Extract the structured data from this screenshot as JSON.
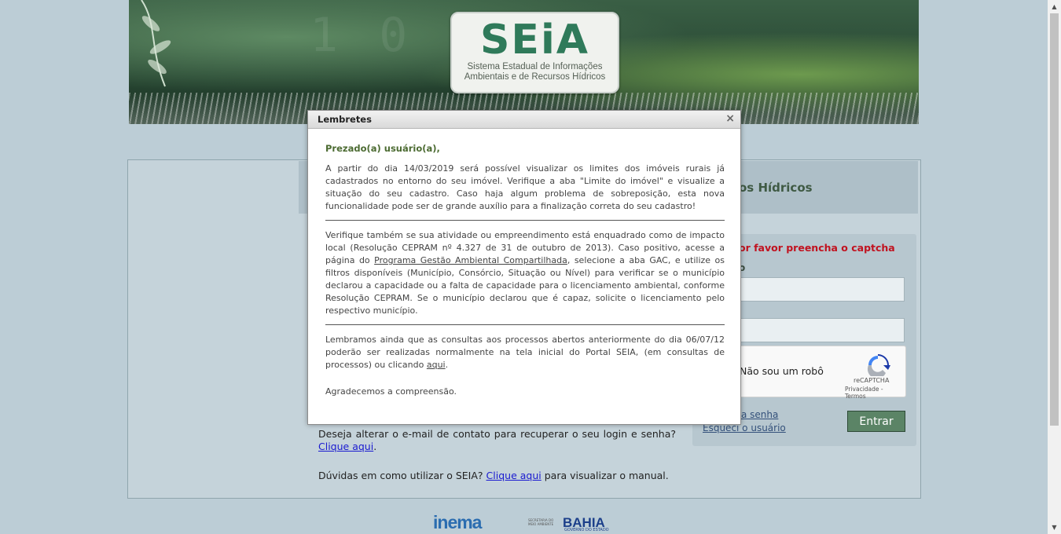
{
  "header": {
    "logo_word": "SEiA",
    "logo_sub_line1": "Sistema Estadual de Informações",
    "logo_sub_line2": "Ambientais e de Recursos Hídricos"
  },
  "panel": {
    "title_visible": "os Hídricos"
  },
  "login": {
    "captcha_message": "or favor preencha o captcha",
    "field_label": "o",
    "recaptcha_label": "Não sou um robô",
    "recaptcha_brand": "reCAPTCHA",
    "recaptcha_terms": "Privacidade - Termos",
    "link_senha": "a senha",
    "link_usuario": "Esqueci o usuário",
    "submit_label": "Entrar"
  },
  "lower": {
    "email_question": "Deseja alterar o e-mail de contato para recuperar o seu login e senha?",
    "email_link": "Clique aqui",
    "email_tail": ".",
    "manual_prefix": "Dúvidas em como utilizar o SEIA?",
    "manual_link": "Clique aqui",
    "manual_suffix": "para visualizar o manual."
  },
  "footer": {
    "inema": "inema",
    "sema_line1": "SECRETARIA DO",
    "sema_line2": "MEIO AMBIENTE",
    "bahia": "BAHIA",
    "bahia_sub": "GOVERNO DO ESTADO"
  },
  "modal": {
    "title": "Lembretes",
    "close": "×",
    "greeting": "Prezado(a) usuário(a),",
    "p1": "A partir do dia 14/03/2019 será possível visualizar os limites dos imóveis rurais já cadastrados no entorno do seu imóvel. Verifique a aba \"Limite do imóvel\" e visualize a situação do seu cadastro. Caso haja algum problema de sobreposição, esta nova funcionalidade pode ser de grande auxílio para a finalização correta do seu cadastro!",
    "p2_before_link": "Verifique também se sua atividade ou empreendimento está enquadrado como de impacto local (Resolução CEPRAM nº 4.327 de 31 de outubro de 2013). Caso positivo, acesse a página do ",
    "p2_link": "Programa Gestão Ambiental Compartilhada",
    "p2_after_link": ", selecione a aba GAC, e utilize os filtros disponíveis (Município, Consórcio, Situação ou Nível) para verificar se o município declarou a capacidade ou a falta de capacidade para o licenciamento ambiental, conforme Resolução CEPRAM. Se o município declarou que é capaz, solicite o licenciamento pelo respectivo município.",
    "p3_before_link": "Lembramos ainda que as consultas aos processos abertos anteriormente do dia 06/07/12 poderão ser realizadas normalmente na tela inicial do Portal SEIA, (em consultas de processos) ou clicando ",
    "p3_link": "aqui",
    "p3_after_link": ".",
    "thanks": "Agradecemos a compreensão."
  },
  "colors": {
    "accent_green": "#5b8466",
    "error_red": "#c1121f",
    "link_blue": "#1a1ad0",
    "background": "#bccdd6"
  }
}
